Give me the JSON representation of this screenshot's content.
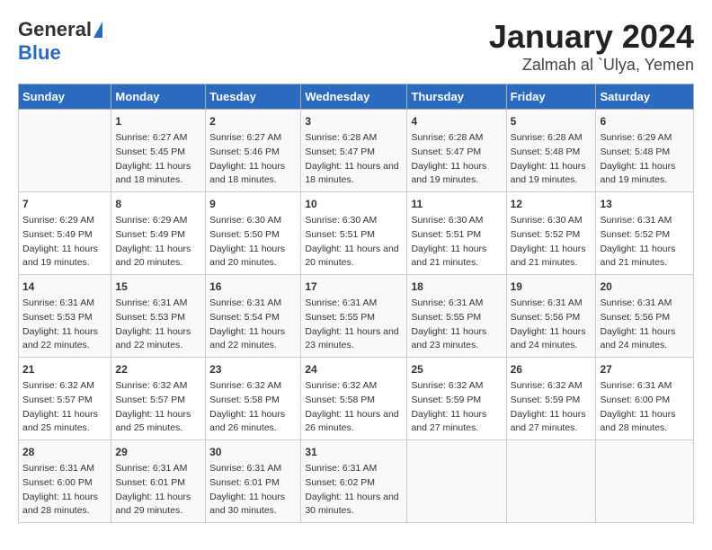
{
  "header": {
    "logo_general": "General",
    "logo_blue": "Blue",
    "title": "January 2024",
    "subtitle": "Zalmah al `Ulya, Yemen"
  },
  "columns": [
    "Sunday",
    "Monday",
    "Tuesday",
    "Wednesday",
    "Thursday",
    "Friday",
    "Saturday"
  ],
  "weeks": [
    [
      {
        "day": "",
        "info": ""
      },
      {
        "day": "1",
        "info": "Sunrise: 6:27 AM\nSunset: 5:45 PM\nDaylight: 11 hours and 18 minutes."
      },
      {
        "day": "2",
        "info": "Sunrise: 6:27 AM\nSunset: 5:46 PM\nDaylight: 11 hours and 18 minutes."
      },
      {
        "day": "3",
        "info": "Sunrise: 6:28 AM\nSunset: 5:47 PM\nDaylight: 11 hours and 18 minutes."
      },
      {
        "day": "4",
        "info": "Sunrise: 6:28 AM\nSunset: 5:47 PM\nDaylight: 11 hours and 19 minutes."
      },
      {
        "day": "5",
        "info": "Sunrise: 6:28 AM\nSunset: 5:48 PM\nDaylight: 11 hours and 19 minutes."
      },
      {
        "day": "6",
        "info": "Sunrise: 6:29 AM\nSunset: 5:48 PM\nDaylight: 11 hours and 19 minutes."
      }
    ],
    [
      {
        "day": "7",
        "info": "Sunrise: 6:29 AM\nSunset: 5:49 PM\nDaylight: 11 hours and 19 minutes."
      },
      {
        "day": "8",
        "info": "Sunrise: 6:29 AM\nSunset: 5:49 PM\nDaylight: 11 hours and 20 minutes."
      },
      {
        "day": "9",
        "info": "Sunrise: 6:30 AM\nSunset: 5:50 PM\nDaylight: 11 hours and 20 minutes."
      },
      {
        "day": "10",
        "info": "Sunrise: 6:30 AM\nSunset: 5:51 PM\nDaylight: 11 hours and 20 minutes."
      },
      {
        "day": "11",
        "info": "Sunrise: 6:30 AM\nSunset: 5:51 PM\nDaylight: 11 hours and 21 minutes."
      },
      {
        "day": "12",
        "info": "Sunrise: 6:30 AM\nSunset: 5:52 PM\nDaylight: 11 hours and 21 minutes."
      },
      {
        "day": "13",
        "info": "Sunrise: 6:31 AM\nSunset: 5:52 PM\nDaylight: 11 hours and 21 minutes."
      }
    ],
    [
      {
        "day": "14",
        "info": "Sunrise: 6:31 AM\nSunset: 5:53 PM\nDaylight: 11 hours and 22 minutes."
      },
      {
        "day": "15",
        "info": "Sunrise: 6:31 AM\nSunset: 5:53 PM\nDaylight: 11 hours and 22 minutes."
      },
      {
        "day": "16",
        "info": "Sunrise: 6:31 AM\nSunset: 5:54 PM\nDaylight: 11 hours and 22 minutes."
      },
      {
        "day": "17",
        "info": "Sunrise: 6:31 AM\nSunset: 5:55 PM\nDaylight: 11 hours and 23 minutes."
      },
      {
        "day": "18",
        "info": "Sunrise: 6:31 AM\nSunset: 5:55 PM\nDaylight: 11 hours and 23 minutes."
      },
      {
        "day": "19",
        "info": "Sunrise: 6:31 AM\nSunset: 5:56 PM\nDaylight: 11 hours and 24 minutes."
      },
      {
        "day": "20",
        "info": "Sunrise: 6:31 AM\nSunset: 5:56 PM\nDaylight: 11 hours and 24 minutes."
      }
    ],
    [
      {
        "day": "21",
        "info": "Sunrise: 6:32 AM\nSunset: 5:57 PM\nDaylight: 11 hours and 25 minutes."
      },
      {
        "day": "22",
        "info": "Sunrise: 6:32 AM\nSunset: 5:57 PM\nDaylight: 11 hours and 25 minutes."
      },
      {
        "day": "23",
        "info": "Sunrise: 6:32 AM\nSunset: 5:58 PM\nDaylight: 11 hours and 26 minutes."
      },
      {
        "day": "24",
        "info": "Sunrise: 6:32 AM\nSunset: 5:58 PM\nDaylight: 11 hours and 26 minutes."
      },
      {
        "day": "25",
        "info": "Sunrise: 6:32 AM\nSunset: 5:59 PM\nDaylight: 11 hours and 27 minutes."
      },
      {
        "day": "26",
        "info": "Sunrise: 6:32 AM\nSunset: 5:59 PM\nDaylight: 11 hours and 27 minutes."
      },
      {
        "day": "27",
        "info": "Sunrise: 6:31 AM\nSunset: 6:00 PM\nDaylight: 11 hours and 28 minutes."
      }
    ],
    [
      {
        "day": "28",
        "info": "Sunrise: 6:31 AM\nSunset: 6:00 PM\nDaylight: 11 hours and 28 minutes."
      },
      {
        "day": "29",
        "info": "Sunrise: 6:31 AM\nSunset: 6:01 PM\nDaylight: 11 hours and 29 minutes."
      },
      {
        "day": "30",
        "info": "Sunrise: 6:31 AM\nSunset: 6:01 PM\nDaylight: 11 hours and 30 minutes."
      },
      {
        "day": "31",
        "info": "Sunrise: 6:31 AM\nSunset: 6:02 PM\nDaylight: 11 hours and 30 minutes."
      },
      {
        "day": "",
        "info": ""
      },
      {
        "day": "",
        "info": ""
      },
      {
        "day": "",
        "info": ""
      }
    ]
  ]
}
